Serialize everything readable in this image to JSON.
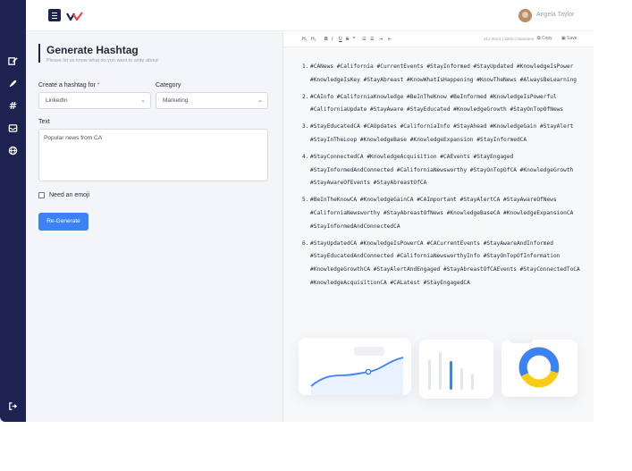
{
  "header": {
    "user_name": "Angela Taylor"
  },
  "sidebar": {
    "items": [
      {
        "icon": "edit-icon"
      },
      {
        "icon": "rocket-icon"
      },
      {
        "icon": "hashtag-icon"
      },
      {
        "icon": "inbox-icon"
      },
      {
        "icon": "globe-icon"
      }
    ],
    "logout_icon": "logout-icon"
  },
  "form": {
    "title": "Generate Hashtag",
    "subtitle": "Please let us know what do you want to write about",
    "platform_label": "Create a hashtag for",
    "platform_required_mark": "*",
    "platform_value": "LinkedIn",
    "category_label": "Category",
    "category_value": "Marketing",
    "text_label": "Text",
    "text_value": "Popular news from CA",
    "emoji_label": "Need an emoji",
    "regenerate_label": "Re-Generate"
  },
  "editor": {
    "toolbar": {
      "h1": "H₁",
      "h2": "H₂",
      "bold": "B",
      "italic": "I",
      "underline": "U",
      "strike": "S",
      "quote": "❞",
      "bullet_list": "☰",
      "ordered_list": "☰",
      "indent": "⇥",
      "outdent": "⇤",
      "stats": "312 Word | 2000 Characters",
      "copy_label": "Copy",
      "save_label": "Save"
    },
    "results": [
      {
        "number": "1.",
        "text": "#CANews #California #CurrentEvents #StayInformed #StayUpdated #KnowledgeIsPower #KnowledgeIsKey #StayAbreast #KnowWhatIsHappening #KnowTheNews #AlwaysBeLearning"
      },
      {
        "number": "2.",
        "text": "#CAInfo #CaliforniaKnowledge #BeInTheKnow #BeInformed #KnowledgeIsPowerful #CaliforniaUpdate #StayAware #StayEducated #KnowledgeGrowth #StayOnTopOfNews"
      },
      {
        "number": "3.",
        "text": "#StayEducatedCA #CAUpdates #CaliforniaInfo #StayAhead #KnowledgeGain #StayAlert #StayInTheLoop #KnowledgeBase #KnowledgeExpansion #StayInformedCA"
      },
      {
        "number": "4.",
        "text": "#StayConnectedCA #KnowledgeAcquisition #CAEvents #StayEngaged #StayInformedAndConnected #CaliforniaNewsworthy #StayOnTopOfCA #KnowledgeGrowth #StayAwareOfEvents #StayAbreastOfCA"
      },
      {
        "number": "5.",
        "text": "#BeInTheKnowCA #KnowledgeGainCA #CAImportant #StayAlertCA #StayAwareOfNews #CaliforniaNewsworthy #StayAbreastOfNews #KnowledgeBaseCA #KnowledgeExpansionCA #StayInformedAndConnectedCA"
      },
      {
        "number": "6.",
        "text": "#StayUpdatedCA #KnowledgeIsPowerCA #CACurrentEvents #StayAwareAndInformed #StayEducatedAndConnected #CaliforniaNewsworthyInfo #StayOnTopOfInformation #KnowledgeGrowthCA #StayAlertAndEngaged #StayAbreastOfCAEvents #StayConnectedToCA #KnowledgeAcquisitionCA #CALatest #StayEngagedCA"
      }
    ]
  },
  "colors": {
    "sidebar": "#1e2250",
    "accent": "#3b82f6",
    "required": "#ef4444",
    "donut_blue": "#3b82f6",
    "donut_yellow": "#facc15"
  }
}
